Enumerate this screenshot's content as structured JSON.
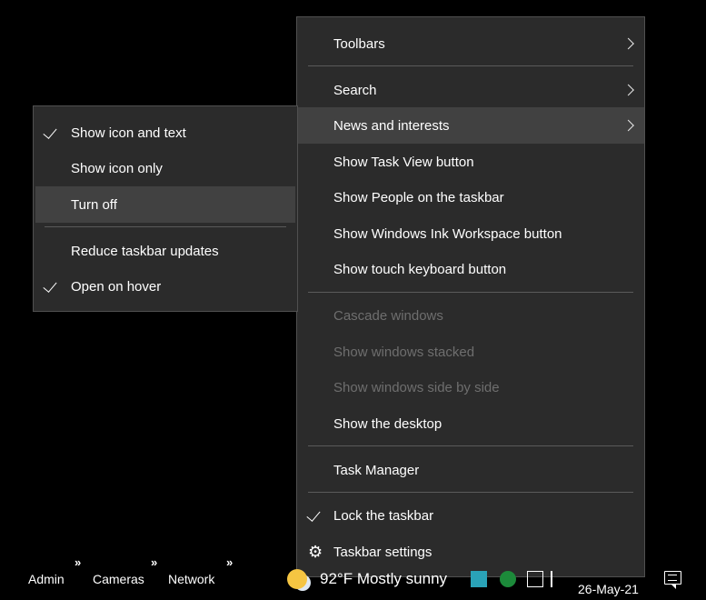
{
  "context_menu": {
    "toolbars": "Toolbars",
    "search": "Search",
    "news_and_interests": "News and interests",
    "show_task_view": "Show Task View button",
    "show_people": "Show People on the taskbar",
    "show_ink": "Show Windows Ink Workspace button",
    "show_touch_keyboard": "Show touch keyboard button",
    "cascade_windows": "Cascade windows",
    "show_windows_stacked": "Show windows stacked",
    "show_windows_side_by_side": "Show windows side by side",
    "show_desktop": "Show the desktop",
    "task_manager": "Task Manager",
    "lock_taskbar": "Lock the taskbar",
    "taskbar_settings": "Taskbar settings"
  },
  "news_submenu": {
    "show_icon_and_text": "Show icon and text",
    "show_icon_only": "Show icon only",
    "turn_off": "Turn off",
    "reduce_updates": "Reduce taskbar updates",
    "open_on_hover": "Open on hover"
  },
  "taskbar": {
    "toolbar_arrow": "»",
    "toolbars": [
      "Admin",
      "Cameras",
      "Network"
    ],
    "weather": "92°F  Mostly sunny",
    "date": "26-May-21"
  },
  "colors": {
    "menu_bg": "#2b2b2b",
    "hover_bg": "#414141",
    "disabled_text": "#6e6e6e"
  },
  "icons": [
    "chevron-right-icon",
    "checkmark-icon",
    "gear-icon",
    "weather-icon",
    "notification-icon"
  ]
}
